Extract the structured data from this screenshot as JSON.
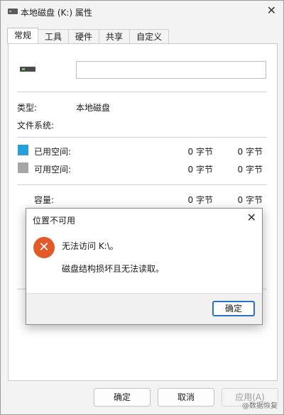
{
  "window": {
    "title": "本地磁盘 (K:) 属性",
    "close_glyph": "✕"
  },
  "tabs": [
    "常规",
    "工具",
    "硬件",
    "共享",
    "自定义"
  ],
  "general": {
    "name_value": "",
    "type_label": "类型:",
    "type_value": "本地磁盘",
    "fs_label": "文件系统:",
    "used_label": "已用空间:",
    "used_bytes": "0 字节",
    "used_size": "0 字节",
    "free_label": "可用空间:",
    "free_bytes": "0 字节",
    "free_size": "0 字节",
    "capacity_label": "容量:",
    "capacity_bytes": "0 字节",
    "capacity_size": "0 字节",
    "used_color": "#26a0da",
    "free_color": "#a6a6a6"
  },
  "dialog": {
    "title": "位置不可用",
    "close_glyph": "✕",
    "icon_glyph": "✕",
    "line1": "无法访问 K:\\。",
    "line2": "磁盘结构损坏且无法读取。",
    "ok_label": "确定"
  },
  "buttons": {
    "ok": "确定",
    "cancel": "取消",
    "apply": "应用(A)"
  },
  "watermark": "@数据恢复"
}
